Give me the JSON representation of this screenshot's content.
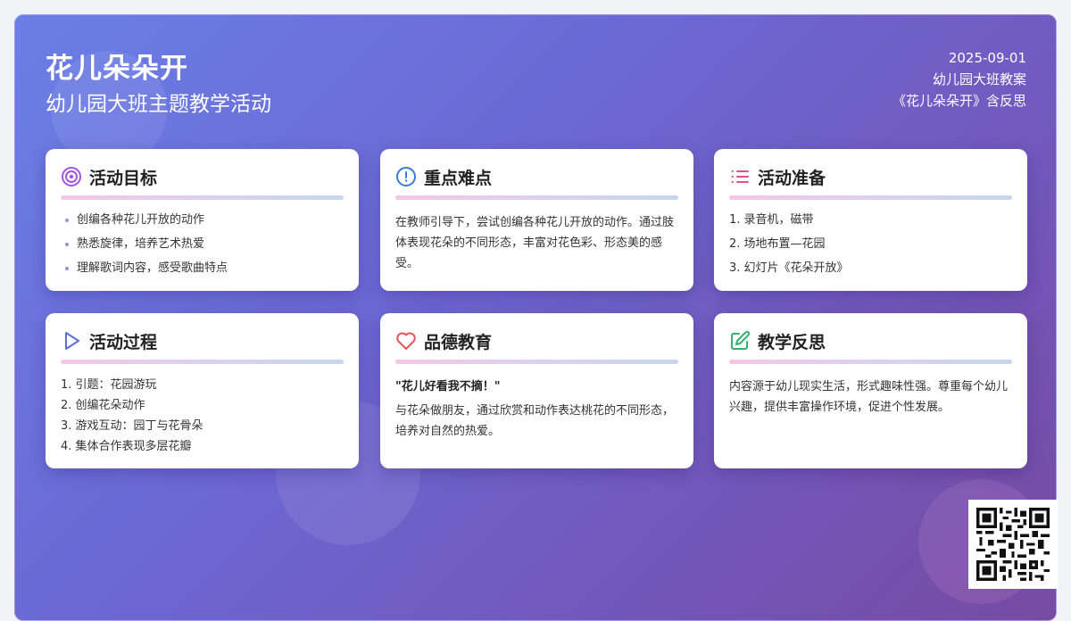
{
  "header": {
    "title": "花儿朵朵开",
    "subtitle": "幼儿园大班主题教学活动",
    "date": "2025-09-01",
    "meta_line1": "幼儿园大班教案",
    "meta_line2": "《花儿朵朵开》含反思"
  },
  "cards": {
    "goals": {
      "title": "活动目标",
      "icon": "target-icon",
      "items": [
        "创编各种花儿开放的动作",
        "熟悉旋律，培养艺术热爱",
        "理解歌词内容，感受歌曲特点"
      ]
    },
    "key_points": {
      "title": "重点难点",
      "icon": "alert-circle-icon",
      "text": "在教师引导下，尝试创编各种花儿开放的动作。通过肢体表现花朵的不同形态，丰富对花色彩、形态美的感受。"
    },
    "prep": {
      "title": "活动准备",
      "icon": "list-icon",
      "items": [
        "1. 录音机，磁带",
        "2. 场地布置—花园",
        "3. 幻灯片《花朵开放》"
      ]
    },
    "process": {
      "title": "活动过程",
      "icon": "play-icon",
      "items": [
        "1. 引题：花园游玩",
        "2. 创编花朵动作",
        "3. 游戏互动：园丁与花骨朵",
        "4. 集体合作表现多层花瓣"
      ]
    },
    "morals": {
      "title": "品德教育",
      "icon": "heart-icon",
      "quote": "\"花儿好看我不摘！\"",
      "text": "与花朵做朋友，通过欣赏和动作表达桃花的不同形态，培养对自然的热爱。"
    },
    "reflection": {
      "title": "教学反思",
      "icon": "edit-icon",
      "text": "内容源于幼儿现实生活，形式趣味性强。尊重每个幼儿兴趣，提供丰富操作环境，促进个性发展。"
    }
  },
  "colors": {
    "bg_start": "#6a7fe6",
    "bg_end": "#764ba2",
    "target": "#a155e0",
    "alert": "#3a7bd5",
    "list": "#e0508a",
    "play": "#5b6fd6",
    "heart": "#e05656",
    "edit": "#2fb36d"
  }
}
